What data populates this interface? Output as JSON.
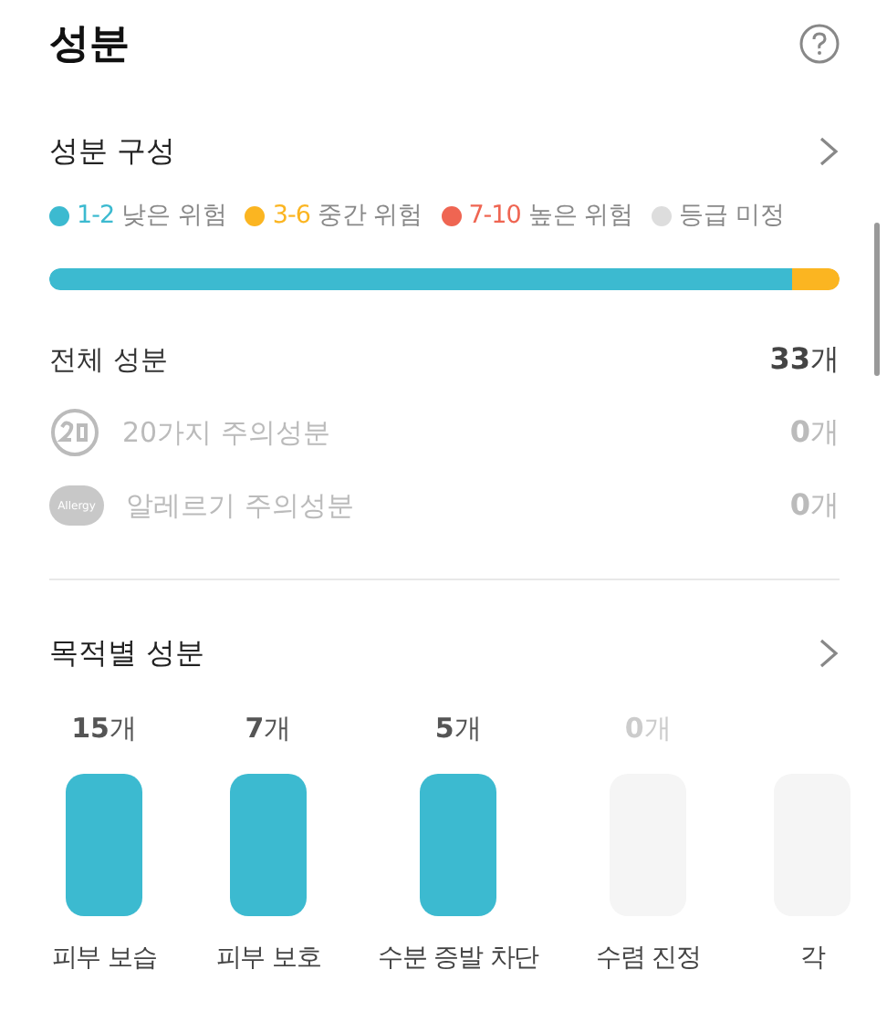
{
  "title": "성분",
  "composition": {
    "heading": "성분 구성",
    "legend": [
      {
        "range": "1-2",
        "label": "낮은 위험",
        "color": "#3cbad0"
      },
      {
        "range": "3-6",
        "label": "중간 위험",
        "color": "#fbb521"
      },
      {
        "range": "7-10",
        "label": "높은 위험",
        "color": "#ef6552"
      },
      {
        "label": "등급 미정",
        "color": "#dddddd"
      }
    ],
    "bar": [
      {
        "level": 0.94,
        "color": "#3cbad0"
      },
      {
        "level": 0.06,
        "color": "#fbb521"
      }
    ],
    "total": {
      "label": "전체 성분",
      "count": "**33**개"
    },
    "cautions": [
      {
        "kind": "twenty",
        "label": "20가지 주의성분",
        "count": "**0**개"
      },
      {
        "kind": "allergy",
        "icon_text": "Allergy",
        "label": "알레르기 주의성분",
        "count": "**0**개"
      }
    ]
  },
  "purpose": {
    "heading": "목적별 성분",
    "items": [
      {
        "count": "**15**개",
        "label": "피부 보습",
        "filled": true
      },
      {
        "count": "**7**개",
        "label": "피부 보호",
        "filled": true
      },
      {
        "count": "**5**개",
        "label": "수분 증발 차단",
        "filled": true
      },
      {
        "count": "**0**개",
        "label": "수렴 진정",
        "filled": false
      },
      {
        "label": "각",
        "filled": false
      }
    ]
  }
}
